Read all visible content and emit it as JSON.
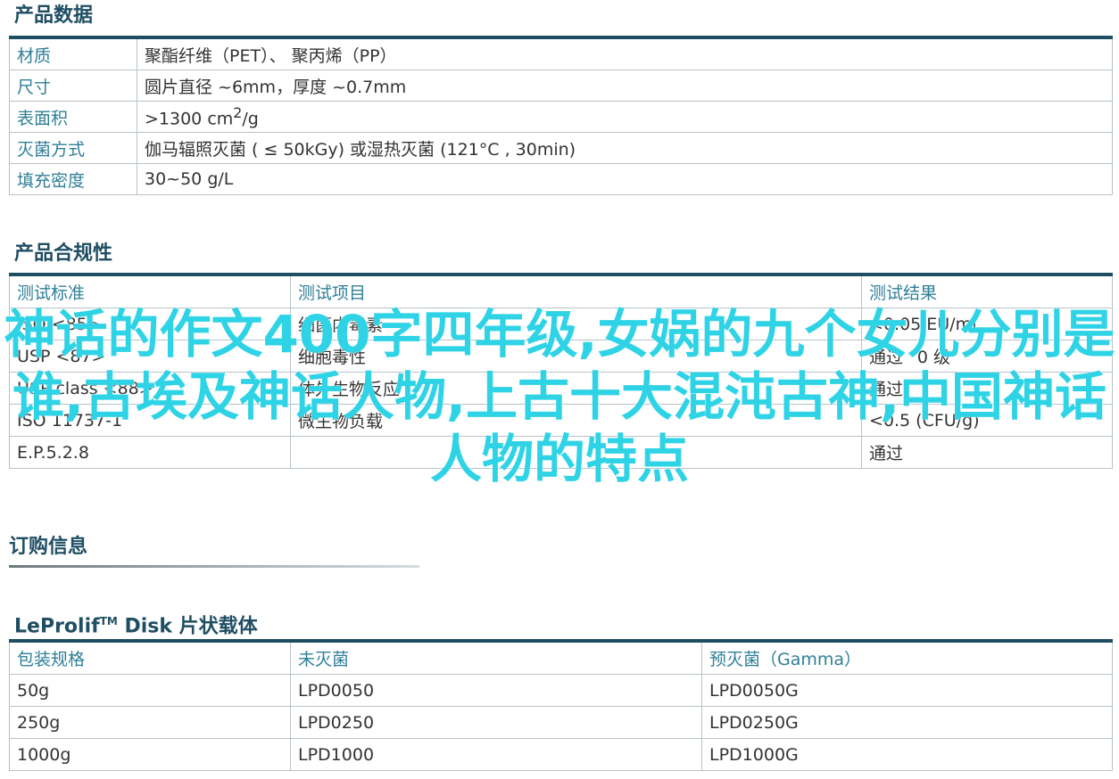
{
  "spec": {
    "title": "产品数据",
    "rows": [
      {
        "label": "材质",
        "value": "聚酯纤维（PET）、 聚丙烯（PP）"
      },
      {
        "label": "尺寸",
        "value": "圆片直径 ~6mm，厚度 ~0.7mm"
      },
      {
        "label": "表面积",
        "value_pre": ">1300 cm",
        "value_sup": "2",
        "value_post": "/g"
      },
      {
        "label": "灭菌方式",
        "value": "伽马辐照灭菌 ( ≤ 50kGy) 或湿热灭菌 (121°C , 30min)"
      },
      {
        "label": "填充密度",
        "value": "30~50 g/L"
      }
    ]
  },
  "compliance": {
    "title": "产品合规性",
    "headers": [
      "测试标准",
      "测试项目",
      "测试结果"
    ],
    "rows": [
      [
        "ISO <85>",
        "细菌内毒素",
        "<0.05 EU/mL"
      ],
      [
        "USP <87>",
        "细胞毒性",
        "通过 “0 级”"
      ],
      [
        "USP class <88>",
        "体外生物反应",
        "通过"
      ],
      [
        "ISO 11737-1",
        "微生物负载",
        "<0.5 (CFU/g)"
      ],
      [
        "E.P.5.2.8",
        "",
        "通过"
      ]
    ]
  },
  "ordering": {
    "title": "订购信息",
    "product_name": "LeProlif",
    "product_tm": "TM",
    "product_suffix": " Disk 片状载体",
    "headers": [
      "包装规格",
      "未灭菌",
      "预灭菌（Gamma）"
    ],
    "rows": [
      [
        "50g",
        "LPD0050",
        "LPD0050G"
      ],
      [
        "250g",
        "LPD0250",
        "LPD0250G"
      ],
      [
        "1000g",
        "LPD1000",
        "LPD1000G"
      ]
    ]
  },
  "overlay_text": "神话的作文400字四年级,女娲的九个女儿分别是谁,古埃及神话人物,上古十大混沌古神,中国神话人物的特点",
  "colors": {
    "heading": "#1f4e63",
    "label": "#2f7f97",
    "overlay": "#2fd3e6",
    "border": "#b7c2c8"
  }
}
